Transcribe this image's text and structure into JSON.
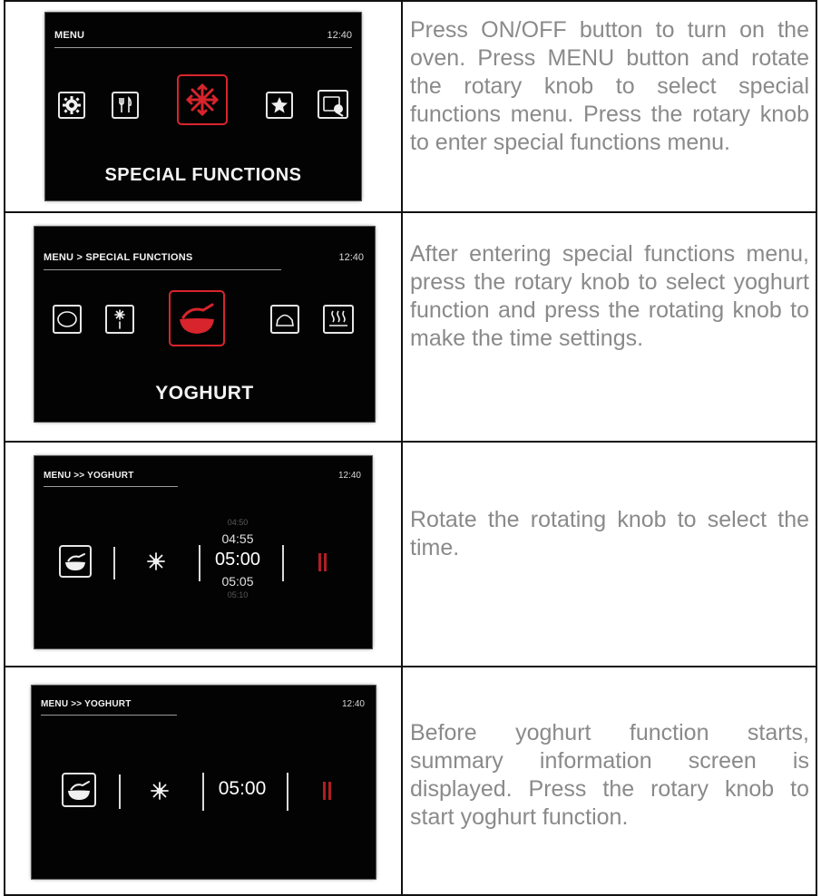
{
  "rows": [
    {
      "screen": {
        "breadcrumb": "MENU",
        "time": "12:40",
        "label": "SPECIAL FUNCTIONS",
        "icons": [
          "gear-icon",
          "cutlery-icon",
          "snowflake-icon",
          "star-icon",
          "cleaning-icon"
        ]
      },
      "description": "Press ON/OFF button to turn on the oven. Press MENU button and rotate the rotary knob to select special functions menu. Press the rotary knob to enter special functions menu."
    },
    {
      "screen": {
        "breadcrumb": "MENU > SPECIAL FUNCTIONS",
        "time": "12:40",
        "label": "YOGHURT",
        "icons": [
          "defrost-dish-icon",
          "thaw-icon",
          "yoghurt-bowl-icon",
          "dough-icon",
          "steam-icon"
        ]
      },
      "description": "After entering special functions menu, press the rotary knob to select yoghurt function and press the rotating knob to make the time settings."
    },
    {
      "screen": {
        "breadcrumb": "MENU >> YOGHURT",
        "time": "12:40",
        "times": [
          "04:50",
          "04:55",
          "05:00",
          "05:05",
          "05:10"
        ],
        "icons": [
          "yoghurt-bowl-icon",
          "sun-icon",
          "pause-icon"
        ]
      },
      "description": "Rotate the rotating knob to select the time."
    },
    {
      "screen": {
        "breadcrumb": "MENU >> YOGHURT",
        "time": "12:40",
        "selected_time": "05:00",
        "icons": [
          "yoghurt-bowl-icon",
          "sun-icon",
          "pause-icon"
        ]
      },
      "description": "Before yoghurt function starts, summary information screen is displayed. Press the rotary knob to start yoghurt function."
    }
  ],
  "colors": {
    "accent": "#d8242c",
    "text": "#8a8a8a",
    "screen_bg": "#030303"
  }
}
